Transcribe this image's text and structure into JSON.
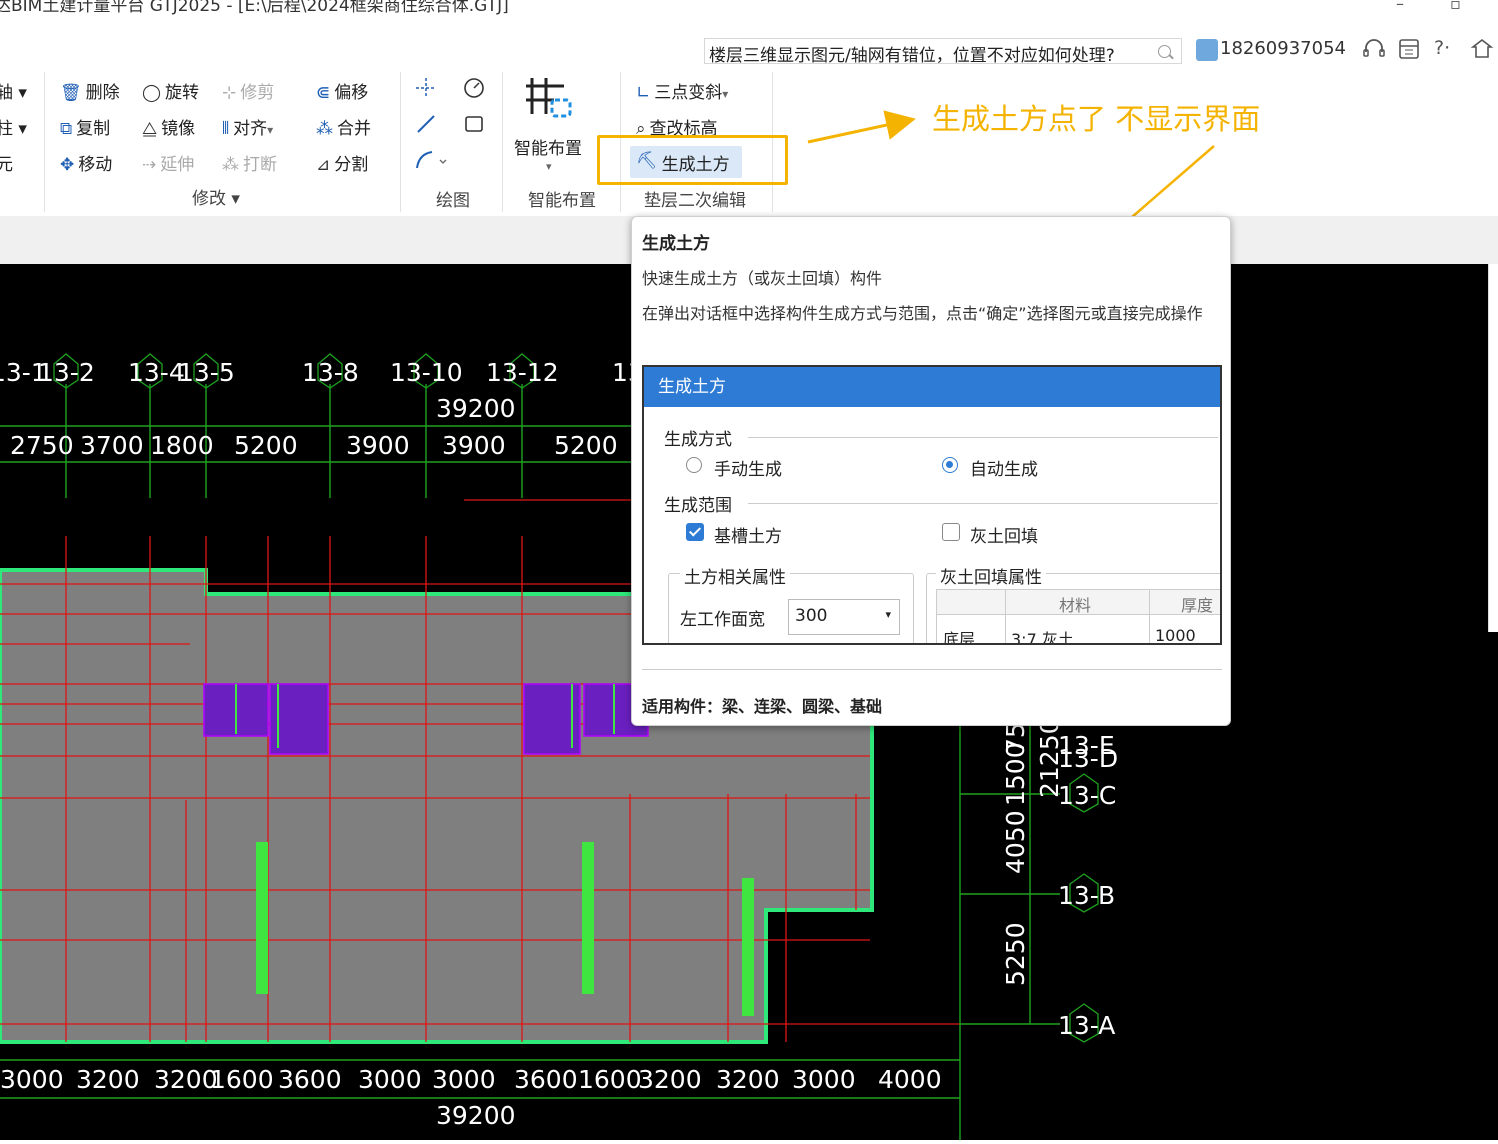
{
  "titlebar": {
    "title": "达BIM土建计量平台 GTJ2025 - [E:\\后程\\2024框架商住综合体.GTJ]",
    "minimize_icon": "–",
    "restore_icon": "▫"
  },
  "helpbar": {
    "search_text": "楼层三维显示图元/轴网有错位，位置不对应如何处理?",
    "phone": "18260937054",
    "icons": [
      "headset-icon",
      "calculator-icon",
      "help-icon",
      "settings-icon"
    ],
    "help_label": "?·"
  },
  "ribbon": {
    "left_partial": [
      "轴 ▾",
      "柱 ▾",
      "元"
    ],
    "modify": {
      "delete": "删除",
      "rotate": "旋转",
      "trim": "修剪",
      "offset": "偏移",
      "copy": "复制",
      "mirror": "镜像",
      "align": "对齐",
      "align_arrow": "▾",
      "merge": "合并",
      "move": "移动",
      "extend": "延伸",
      "break": "打断",
      "split": "分割",
      "group": "修改 ▾"
    },
    "draw": {
      "group": "绘图"
    },
    "smart": {
      "label": "智能布置",
      "arrow": "▾",
      "group": "智能布置"
    },
    "pad": {
      "three_point": "三点变斜",
      "three_point_arrow": "▾",
      "check_elev": "查改标高",
      "gen_earth": "生成土方",
      "group": "垫层二次编辑"
    }
  },
  "annotation": {
    "text": "生成土方点了 不显示界面",
    "color": "#f5b301"
  },
  "tooltip": {
    "title": "生成土方",
    "desc": "快速生成土方（或灰土回填）构件",
    "detail": "在弹出对话框中选择构件生成方式与范围，点击“确定”选择图元或直接完成操作",
    "preview": {
      "title": "生成土方",
      "mode_label": "生成方式",
      "manual": "手动生成",
      "auto": "自动生成",
      "mode_selected": "auto",
      "range_label": "生成范围",
      "pit": "基槽土方",
      "pit_checked": true,
      "backfill": "灰土回填",
      "backfill_checked": false,
      "earth_props": "土方相关属性",
      "backfill_props": "灰土回填属性",
      "left_width_label": "左工作面宽",
      "left_width_value": "300",
      "col_material": "材料",
      "col_thickness": "厚度",
      "row_layer": "底层",
      "row_material": "3:7 灰土",
      "row_thickness": "1000"
    },
    "footer": "适用构件：梁、连梁、圆梁、基础"
  },
  "cad": {
    "top_axes": [
      "13-1",
      "13-2",
      "13-4",
      "13-5",
      "13-8",
      "13-10",
      "13-12",
      "13"
    ],
    "top_total": "39200",
    "top_dims": [
      "2750",
      "3700",
      "1800",
      "5200",
      "3900",
      "3900",
      "5200"
    ],
    "top_dims_partial": "5",
    "bottom_dims": [
      "3000",
      "3200",
      "3200",
      "1600",
      "3600",
      "3000",
      "3000",
      "3600",
      "1600",
      "3200",
      "3200",
      "3000",
      "4000"
    ],
    "bottom_total": "39200",
    "right_axes": [
      "13-E",
      "13-D",
      "13-C",
      "13-B",
      "13-A"
    ],
    "right_dims": [
      "4050",
      "5250",
      "1500",
      "750",
      "21250"
    ],
    "colors": {
      "background": "#000000",
      "slab": "#7f7f7f",
      "outline": "#2ee87a",
      "red": "#e01515",
      "grid": "#1fa31f",
      "purple": "#6a1fc0",
      "pin": "#3fe63f",
      "text": "#ffffff"
    }
  }
}
